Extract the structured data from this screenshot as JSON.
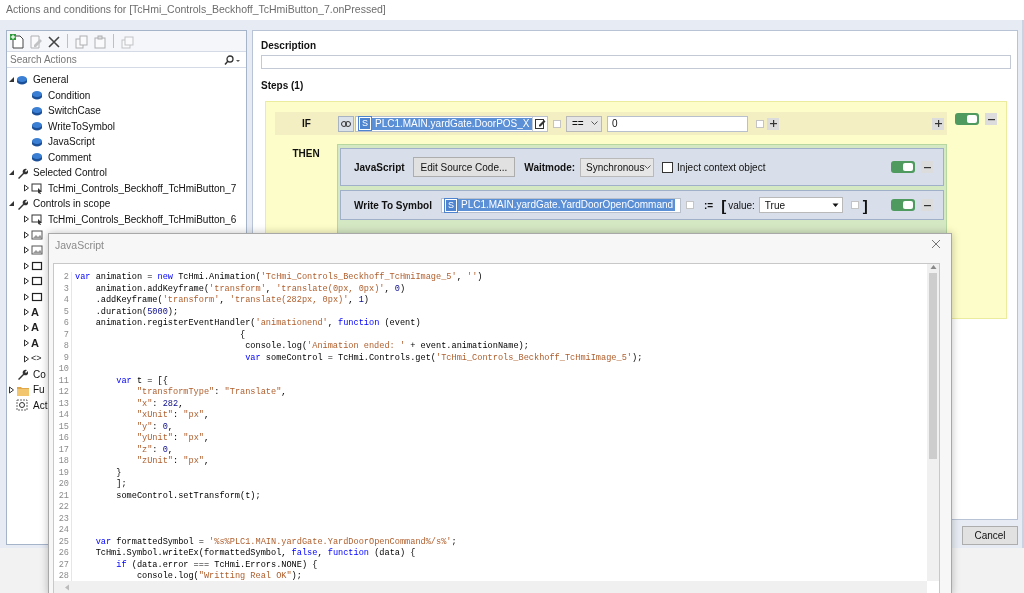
{
  "window": {
    "title": "Actions and conditions for [TcHmi_Controls_Beckhoff_TcHmiButton_7.onPressed]"
  },
  "toolbar": [
    {
      "kind": "new",
      "disabled": false
    },
    {
      "kind": "edit",
      "disabled": true
    },
    {
      "kind": "delete",
      "disabled": false
    },
    {
      "kind": "copy",
      "disabled": true
    },
    {
      "kind": "paste",
      "disabled": true
    },
    {
      "kind": "duplicate",
      "disabled": true
    }
  ],
  "search": {
    "placeholder": "Search Actions"
  },
  "tree": [
    {
      "label": "General",
      "kind": "category",
      "expanded": true,
      "children": [
        {
          "label": "Condition",
          "kind": "action"
        },
        {
          "label": "SwitchCase",
          "kind": "action"
        },
        {
          "label": "WriteToSymbol",
          "kind": "action"
        },
        {
          "label": "JavaScript",
          "kind": "action"
        },
        {
          "label": "Comment",
          "kind": "action"
        }
      ]
    },
    {
      "label": "Selected Control",
      "kind": "tool",
      "expanded": true,
      "children": [
        {
          "label": "TcHmi_Controls_Beckhoff_TcHmiButton_7",
          "kind": "button",
          "expanded": false
        }
      ]
    },
    {
      "label": "Controls in scope",
      "kind": "tool",
      "expanded": true,
      "children": [
        {
          "label": "TcHmi_Controls_Beckhoff_TcHmiButton_6",
          "kind": "button",
          "expanded": false
        },
        {
          "kind": "image",
          "expanded": false
        },
        {
          "kind": "image",
          "expanded": false
        },
        {
          "kind": "box",
          "expanded": false
        },
        {
          "kind": "box",
          "expanded": false
        },
        {
          "kind": "box",
          "expanded": false
        },
        {
          "kind": "text",
          "glyph": "A",
          "expanded": false
        },
        {
          "kind": "text",
          "glyph": "A",
          "expanded": false
        },
        {
          "kind": "text",
          "glyph": "A",
          "expanded": false
        },
        {
          "kind": "html",
          "glyph": "<>",
          "expanded": false
        }
      ]
    },
    {
      "label": "Co",
      "kind": "tool"
    },
    {
      "label": "Fu",
      "kind": "functions",
      "expanded": false
    },
    {
      "label": "Act",
      "kind": "other"
    }
  ],
  "description": {
    "label": "Description"
  },
  "steps": {
    "label": "Steps (1)",
    "items": [
      {
        "kind": "if",
        "keyword": "IF",
        "on": true,
        "condition": {
          "badge": "S",
          "symbol": "PLC1.MAIN.yardGate.DoorPOS_X",
          "operator": "==",
          "value": "0"
        },
        "then_label": "THEN",
        "actions": [
          {
            "kind": "javascript",
            "title": "JavaScript",
            "button": "Edit Source Code...",
            "waitmode_label": "Waitmode:",
            "waitmode": "Synchronous",
            "checkbox_label": "Inject context object",
            "checked": false,
            "on": true
          },
          {
            "kind": "write",
            "title": "Write To Symbol",
            "badge": "S",
            "symbol": "PLC1.MAIN.yardGate.YardDoorOpenCommand",
            "assign": ":=",
            "open_bracket": "[",
            "value_label": "value:",
            "value": "True",
            "close_bracket": "]",
            "on": true
          }
        ]
      }
    ]
  },
  "cancel": "Cancel",
  "dialog": {
    "title": "JavaScript",
    "lines": [
      {
        "number": "2",
        "segments": [
          {
            "kind": "keyword",
            "text": "var"
          },
          {
            "kind": "plain",
            "text": " animation = "
          },
          {
            "kind": "keyword",
            "text": "new"
          },
          {
            "kind": "plain",
            "text": " TcHmi.Animation("
          },
          {
            "kind": "string",
            "text": "'TcHmi_Controls_Beckhoff_TcHmiImage_5'"
          },
          {
            "kind": "plain",
            "text": ", "
          },
          {
            "kind": "string",
            "text": "''"
          },
          {
            "kind": "plain",
            "text": ")"
          }
        ]
      },
      {
        "number": "3",
        "segments": [
          {
            "kind": "plain",
            "text": "    animation.addKeyframe("
          },
          {
            "kind": "string",
            "text": "'transform'"
          },
          {
            "kind": "plain",
            "text": ", "
          },
          {
            "kind": "string",
            "text": "'translate(0px, 0px)'"
          },
          {
            "kind": "plain",
            "text": ", "
          },
          {
            "kind": "number",
            "text": "0"
          },
          {
            "kind": "plain",
            "text": ")"
          }
        ]
      },
      {
        "number": "4",
        "segments": [
          {
            "kind": "plain",
            "text": "    .addKeyframe("
          },
          {
            "kind": "string",
            "text": "'transform'"
          },
          {
            "kind": "plain",
            "text": ", "
          },
          {
            "kind": "string",
            "text": "'translate(282px, 0px)'"
          },
          {
            "kind": "plain",
            "text": ", "
          },
          {
            "kind": "number",
            "text": "1"
          },
          {
            "kind": "plain",
            "text": ")"
          }
        ]
      },
      {
        "number": "5",
        "segments": [
          {
            "kind": "plain",
            "text": "    .duration("
          },
          {
            "kind": "number",
            "text": "5000"
          },
          {
            "kind": "plain",
            "text": ");"
          }
        ]
      },
      {
        "number": "6",
        "segments": [
          {
            "kind": "plain",
            "text": "    animation.registerEventHandler("
          },
          {
            "kind": "string",
            "text": "'animationend'"
          },
          {
            "kind": "plain",
            "text": ", "
          },
          {
            "kind": "keyword",
            "text": "function"
          },
          {
            "kind": "plain",
            "text": " (event)"
          }
        ]
      },
      {
        "number": "7",
        "segments": [
          {
            "kind": "plain",
            "text": "                                {"
          }
        ]
      },
      {
        "number": "8",
        "segments": [
          {
            "kind": "plain",
            "text": "                                 console.log("
          },
          {
            "kind": "string",
            "text": "'Animation ended: '"
          },
          {
            "kind": "plain",
            "text": " + event.animationName);"
          }
        ]
      },
      {
        "number": "9",
        "segments": [
          {
            "kind": "keyword",
            "text": "                                 var"
          },
          {
            "kind": "plain",
            "text": " someControl = TcHmi.Controls.get("
          },
          {
            "kind": "string",
            "text": "'TcHmi_Controls_Beckhoff_TcHmiImage_5'"
          },
          {
            "kind": "plain",
            "text": ");"
          }
        ]
      },
      {
        "number": "10"
      },
      {
        "number": "11",
        "segments": [
          {
            "kind": "keyword",
            "text": "        var"
          },
          {
            "kind": "plain",
            "text": " t = [{"
          }
        ]
      },
      {
        "number": "12",
        "segments": [
          {
            "kind": "string",
            "text": "            \"transformType\""
          },
          {
            "kind": "plain",
            "text": ": "
          },
          {
            "kind": "string",
            "text": "\"Translate\""
          },
          {
            "kind": "plain",
            "text": ","
          }
        ]
      },
      {
        "number": "13",
        "segments": [
          {
            "kind": "string",
            "text": "            \"x\""
          },
          {
            "kind": "plain",
            "text": ": "
          },
          {
            "kind": "number",
            "text": "282"
          },
          {
            "kind": "plain",
            "text": ","
          }
        ]
      },
      {
        "number": "14",
        "segments": [
          {
            "kind": "string",
            "text": "            \"xUnit\""
          },
          {
            "kind": "plain",
            "text": ": "
          },
          {
            "kind": "string",
            "text": "\"px\""
          },
          {
            "kind": "plain",
            "text": ","
          }
        ]
      },
      {
        "number": "15",
        "segments": [
          {
            "kind": "string",
            "text": "            \"y\""
          },
          {
            "kind": "plain",
            "text": ": "
          },
          {
            "kind": "number",
            "text": "0"
          },
          {
            "kind": "plain",
            "text": ","
          }
        ]
      },
      {
        "number": "16",
        "segments": [
          {
            "kind": "string",
            "text": "            \"yUnit\""
          },
          {
            "kind": "plain",
            "text": ": "
          },
          {
            "kind": "string",
            "text": "\"px\""
          },
          {
            "kind": "plain",
            "text": ","
          }
        ]
      },
      {
        "number": "17",
        "segments": [
          {
            "kind": "string",
            "text": "            \"z\""
          },
          {
            "kind": "plain",
            "text": ": "
          },
          {
            "kind": "number",
            "text": "0"
          },
          {
            "kind": "plain",
            "text": ","
          }
        ]
      },
      {
        "number": "18",
        "segments": [
          {
            "kind": "string",
            "text": "            \"zUnit\""
          },
          {
            "kind": "plain",
            "text": ": "
          },
          {
            "kind": "string",
            "text": "\"px\""
          },
          {
            "kind": "plain",
            "text": ","
          }
        ]
      },
      {
        "number": "19",
        "segments": [
          {
            "kind": "plain",
            "text": "        }"
          }
        ]
      },
      {
        "number": "20",
        "segments": [
          {
            "kind": "plain",
            "text": "        ];"
          }
        ]
      },
      {
        "number": "21",
        "segments": [
          {
            "kind": "plain",
            "text": "        someControl.setTransform(t);"
          }
        ]
      },
      {
        "number": "22"
      },
      {
        "number": "23"
      },
      {
        "number": "24"
      },
      {
        "number": "25",
        "segments": [
          {
            "kind": "keyword",
            "text": "    var"
          },
          {
            "kind": "plain",
            "text": " formattedSymbol = "
          },
          {
            "kind": "string",
            "text": "'%s%PLC1.MAIN.yardGate.YardDoorOpenCommand%/s%'"
          },
          {
            "kind": "plain",
            "text": ";"
          }
        ]
      },
      {
        "number": "26",
        "segments": [
          {
            "kind": "plain",
            "text": "    TcHmi.Symbol.writeEx(formattedSymbol, "
          },
          {
            "kind": "keyword",
            "text": "false"
          },
          {
            "kind": "plain",
            "text": ", "
          },
          {
            "kind": "keyword",
            "text": "function"
          },
          {
            "kind": "plain",
            "text": " (data) {"
          }
        ]
      },
      {
        "number": "27",
        "segments": [
          {
            "kind": "keyword",
            "text": "        if"
          },
          {
            "kind": "plain",
            "text": " (data.error === TcHmi.Errors.NONE) {"
          }
        ]
      },
      {
        "number": "28",
        "segments": [
          {
            "kind": "plain",
            "text": "            console.log("
          },
          {
            "kind": "string",
            "text": "\"Writting Real OK\""
          },
          {
            "kind": "plain",
            "text": ");"
          }
        ]
      }
    ]
  }
}
